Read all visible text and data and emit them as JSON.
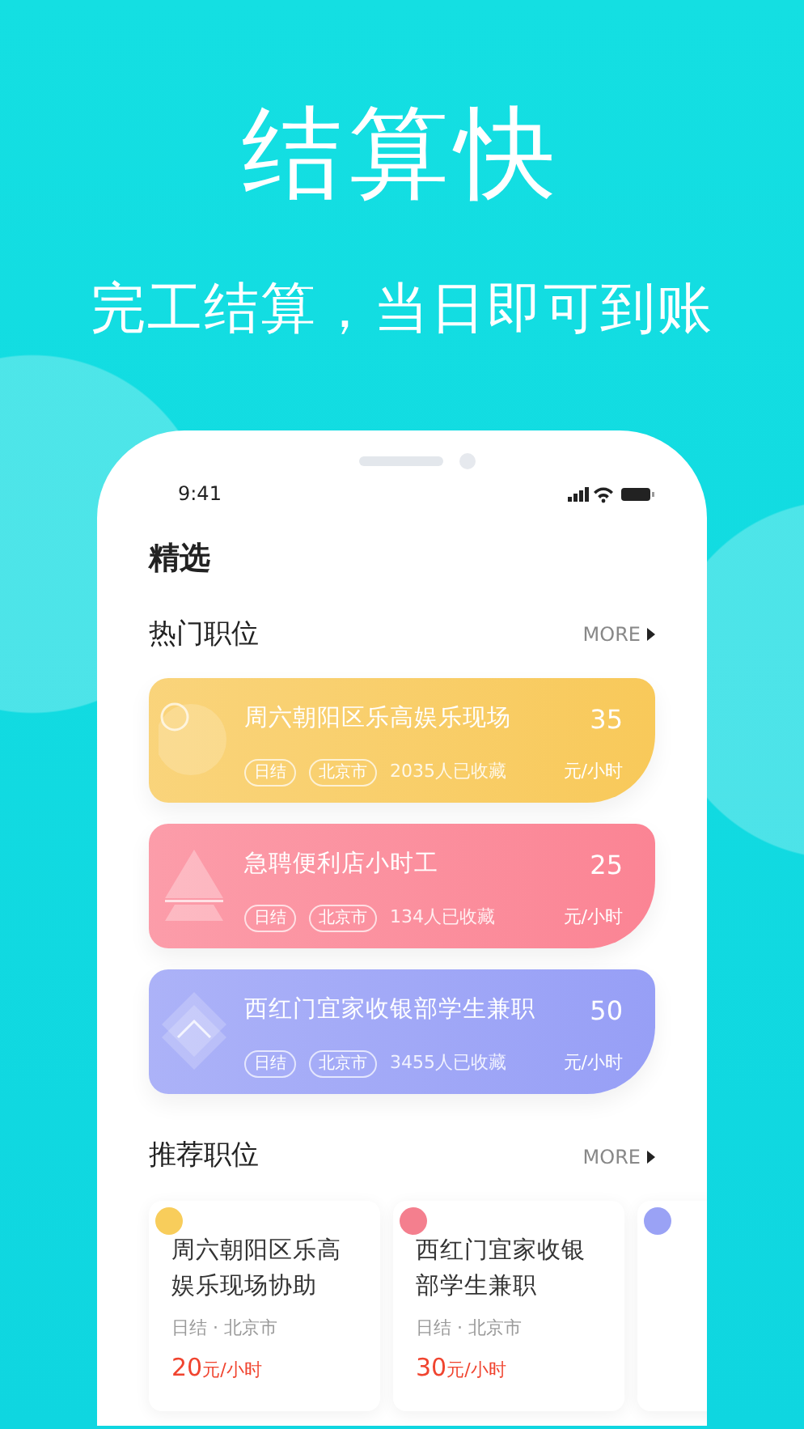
{
  "headline": "结算快",
  "subheadline": "完工结算，当日即可到账",
  "status_bar": {
    "time": "9:41"
  },
  "page_title": "精选",
  "hot_section": {
    "title": "热门职位",
    "more": "MORE"
  },
  "hot_jobs": [
    {
      "title": "周六朝阳区乐高娱乐现场",
      "tags": [
        "日结",
        "北京市"
      ],
      "favorites": "2035人已收藏",
      "price": "35",
      "unit": "元/小时",
      "color": "#f8c95a",
      "kind": "circle"
    },
    {
      "title": "急聘便利店小时工",
      "tags": [
        "日结",
        "北京市"
      ],
      "favorites": "134人已收藏",
      "price": "25",
      "unit": "元/小时",
      "color": "#fb8494",
      "kind": "triangle"
    },
    {
      "title": "西红门宜家收银部学生兼职",
      "tags": [
        "日结",
        "北京市"
      ],
      "favorites": "3455人已收藏",
      "price": "50",
      "unit": "元/小时",
      "color": "#979ff6",
      "kind": "diamond"
    }
  ],
  "recommended_section": {
    "title": "推荐职位",
    "more": "MORE"
  },
  "recommended_jobs": [
    {
      "title": "周六朝阳区乐高娱乐现场协助",
      "meta": "日结 · 北京市",
      "price": "20",
      "unit": "元/小时",
      "color": "#f8cd5b"
    },
    {
      "title": "西红门宜家收银部学生兼职",
      "meta": "日结 · 北京市",
      "price": "30",
      "unit": "元/小时",
      "color": "#f47f8e"
    },
    {
      "color": "#9aa2f5"
    }
  ]
}
